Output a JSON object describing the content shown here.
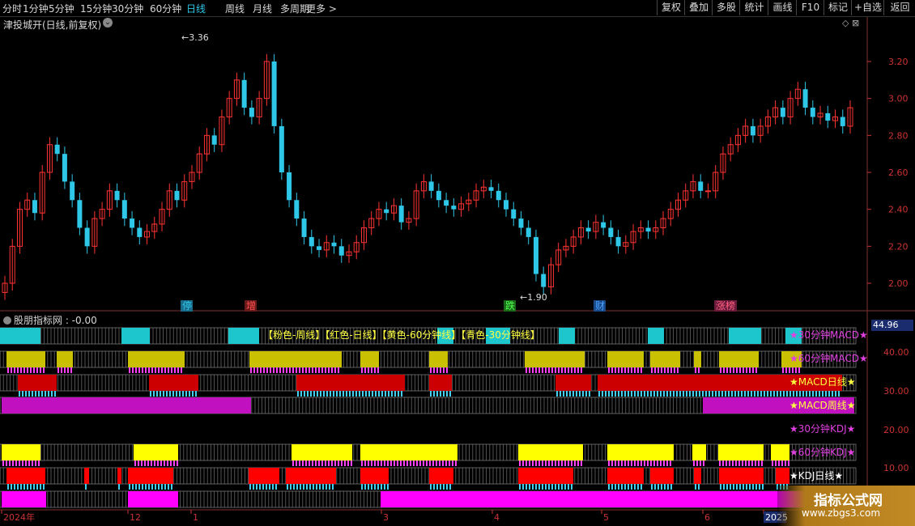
{
  "toolbar": {
    "periods": [
      "分时",
      "1分钟",
      "5分钟",
      "15分钟",
      "30分钟",
      "60分钟",
      "日线",
      "周线",
      "月线",
      "多周期",
      "更多 >"
    ],
    "active_index": 6,
    "right_buttons": [
      "复权",
      "叠加",
      "多股",
      "统计",
      "画线",
      "F10",
      "标记",
      "+自选",
      "返回"
    ]
  },
  "chart_title": "津投城开(日线,前复权)",
  "indicator_title": "股朋指标网 : -0.00",
  "indicator_value": "44.96",
  "annotations": {
    "high_label": "3.36",
    "low_label": "1.90",
    "events": [
      "停",
      "增",
      "跌",
      "财",
      "涨榜"
    ]
  },
  "y_axis_price": [
    "3.20",
    "3.00",
    "2.80",
    "2.60",
    "2.40",
    "2.20",
    "2.00"
  ],
  "y_axis_indicator": [
    "40.00",
    "30.00",
    "20.00",
    "10.00"
  ],
  "x_axis": [
    "2024年",
    "12",
    "1",
    "3",
    "4",
    "5",
    "6",
    "2025"
  ],
  "legend_text": "【粉色-周线】【红色-日线】【黄色-60分钟线】【青色-30分钟线】",
  "row_labels": [
    "★30分钟MACD★",
    "★60分钟MACD★",
    "★MACD日线★",
    "★MACD周线★",
    "★30分钟KDJ★",
    "★60分钟KDJ★",
    "★KDJ日线★"
  ],
  "row_label_colors": [
    "#e040e0",
    "#e040e0",
    "#ffff40",
    "#ffff40",
    "#e040e0",
    "#e040e0",
    "#ffffff"
  ],
  "watermark": {
    "line1": "指标公式网",
    "line2": "www.zbgs3.com"
  },
  "colors": {
    "up": "#ff3333",
    "down": "#2ec7e8",
    "cyan": "#1cc6cc",
    "yellow": "#c8c000",
    "red": "#cc0000",
    "magenta": "#c010c0",
    "bright_yellow": "#ffff00",
    "bright_red": "#ff0000",
    "bright_magenta": "#ff00ff"
  },
  "chart_data": {
    "type": "candlestick",
    "ylim": [
      1.9,
      3.36
    ],
    "high": 3.36,
    "low": 1.9,
    "closes": [
      2.0,
      2.2,
      2.4,
      2.45,
      2.38,
      2.6,
      2.75,
      2.7,
      2.55,
      2.45,
      2.3,
      2.2,
      2.35,
      2.4,
      2.5,
      2.45,
      2.35,
      2.3,
      2.25,
      2.28,
      2.32,
      2.4,
      2.5,
      2.45,
      2.55,
      2.6,
      2.7,
      2.8,
      2.75,
      2.9,
      3.0,
      3.1,
      2.95,
      2.9,
      3.0,
      3.2,
      2.85,
      2.6,
      2.45,
      2.35,
      2.25,
      2.2,
      2.18,
      2.22,
      2.2,
      2.15,
      2.17,
      2.22,
      2.3,
      2.35,
      2.4,
      2.38,
      2.42,
      2.33,
      2.35,
      2.5,
      2.55,
      2.5,
      2.45,
      2.42,
      2.4,
      2.43,
      2.45,
      2.5,
      2.52,
      2.5,
      2.45,
      2.4,
      2.35,
      2.3,
      2.25,
      2.05,
      1.98,
      2.1,
      2.18,
      2.2,
      2.25,
      2.3,
      2.28,
      2.33,
      2.3,
      2.25,
      2.2,
      2.22,
      2.28,
      2.3,
      2.28,
      2.3,
      2.35,
      2.4,
      2.45,
      2.5,
      2.55,
      2.5,
      2.5,
      2.6,
      2.7,
      2.75,
      2.8,
      2.85,
      2.8,
      2.85,
      2.9,
      2.95,
      2.9,
      3.0,
      3.05,
      2.95,
      2.9,
      2.92,
      2.88,
      2.9,
      2.85,
      2.95
    ]
  },
  "strip_rows": [
    {
      "base": "#1cc6cc",
      "segs": [
        [
          0,
          50
        ],
        [
          150,
          185
        ],
        [
          282,
          320
        ],
        [
          540,
          560
        ],
        [
          600,
          630
        ],
        [
          690,
          710
        ],
        [
          800,
          820
        ],
        [
          900,
          940
        ],
        [
          970,
          990
        ]
      ]
    },
    {
      "base": "#c8c000",
      "segs": [
        [
          8,
          56
        ],
        [
          70,
          90
        ],
        [
          158,
          228
        ],
        [
          308,
          422
        ],
        [
          445,
          468
        ],
        [
          530,
          553
        ],
        [
          648,
          722
        ],
        [
          750,
          795
        ],
        [
          803,
          840
        ],
        [
          857,
          866
        ],
        [
          888,
          937
        ],
        [
          965,
          990
        ]
      ]
    },
    {
      "base": "#cc0000",
      "segs": [
        [
          22,
          70
        ],
        [
          184,
          245
        ],
        [
          366,
          500
        ],
        [
          530,
          558
        ],
        [
          686,
          730
        ],
        [
          738,
          1040
        ]
      ]
    },
    {
      "base": "#c010c0",
      "segs": [
        [
          2,
          310
        ],
        [
          868,
          1055
        ]
      ]
    },
    {
      "base": "#ffff00",
      "segs": [
        [
          2,
          50
        ],
        [
          165,
          220
        ],
        [
          360,
          435
        ],
        [
          445,
          565
        ],
        [
          640,
          720
        ],
        [
          750,
          832
        ],
        [
          855,
          872
        ],
        [
          887,
          943
        ],
        [
          952,
          975
        ]
      ]
    },
    {
      "base": "#ff0000",
      "segs": [
        [
          8,
          56
        ],
        [
          104,
          110
        ],
        [
          145,
          150
        ],
        [
          158,
          214
        ],
        [
          307,
          345
        ],
        [
          353,
          415
        ],
        [
          445,
          480
        ],
        [
          530,
          560
        ],
        [
          640,
          708
        ],
        [
          750,
          795
        ],
        [
          803,
          832
        ],
        [
          857,
          866
        ],
        [
          888,
          943
        ],
        [
          958,
          975
        ]
      ]
    },
    {
      "base": "#ff00ff",
      "segs": [
        [
          2,
          57
        ],
        [
          158,
          220
        ],
        [
          470,
          1040
        ]
      ]
    }
  ]
}
